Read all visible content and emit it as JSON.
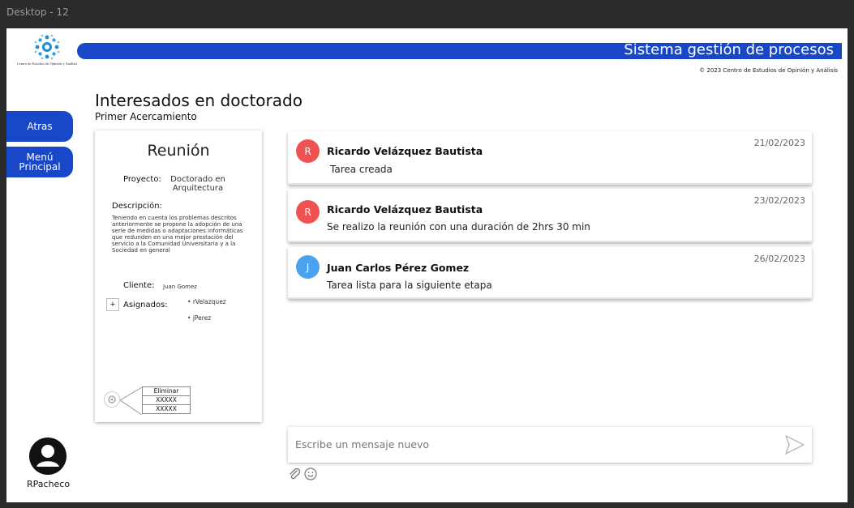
{
  "window": {
    "frame_label": "Desktop - 12"
  },
  "header": {
    "logo_text": "Centro de Estudios de Opinión y Análisis",
    "system_title": "Sistema gestión de procesos",
    "copyright": "© 2023 Centro de Estudios de Opinión y Análisis",
    "brand_color": "#1848c7"
  },
  "page": {
    "title": "Interesados en doctorado",
    "subtitle": "Primer Acercamiento"
  },
  "sidebar": {
    "back_label": "Atras",
    "menu_label": "Menú\nPrincipal",
    "user_name": "RPacheco"
  },
  "card": {
    "title": "Reunión",
    "project_label": "Proyecto:",
    "project_value": "Doctorado en\nArquitectura",
    "description_label": "Descripción:",
    "description_text": "Teniendo en cuenta los problemas descritos anteriormente se propone la adopción de una serie de medidas o adaptaciones informáticas que redunden en una mejor prestación del servicio a la Comunidad Universitaria y a la Sociedad en general",
    "client_label": "Cliente:",
    "client_value": "Juan Gomez",
    "add_label": "+",
    "assigned_label": "Asignados:",
    "assignees": [
      "rVelazquez",
      "jPerez"
    ],
    "context_menu": [
      "Eliminar",
      "XXXXX",
      "XXXXX"
    ]
  },
  "messages": [
    {
      "initial": "R",
      "avatar_color": "#f05252",
      "author": "Ricardo Velázquez Bautista",
      "text": "Tarea creada",
      "date": "21/02/2023"
    },
    {
      "initial": "R",
      "avatar_color": "#f05252",
      "author": "Ricardo Velázquez Bautista",
      "text": "Se realizo la reunión con una duración de 2hrs 30 min",
      "date": "23/02/2023"
    },
    {
      "initial": "J",
      "avatar_color": "#4aa3f0",
      "author": "Juan Carlos Pérez Gomez",
      "text": "Tarea lista para la siguiente etapa",
      "date": "26/02/2023"
    }
  ],
  "composer": {
    "placeholder": "Escribe un mensaje nuevo",
    "value": "",
    "send_icon": "send-icon",
    "attach_icon": "paperclip-icon",
    "emoji_icon": "smiley-icon"
  }
}
